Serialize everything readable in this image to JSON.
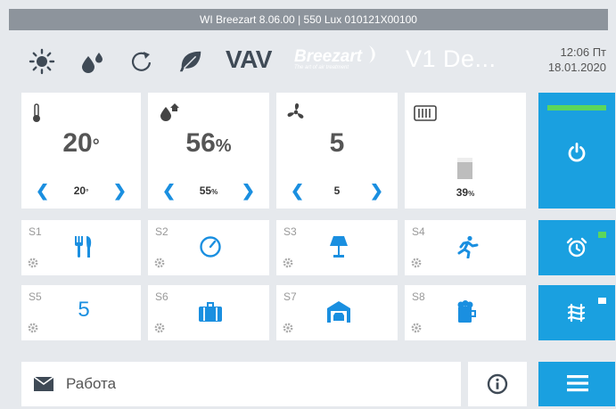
{
  "titlebar": {
    "text": "WI Breezart 8.06.00 | 550 Lux 010121X00100"
  },
  "topbar": {
    "icons": [
      "sun-icon",
      "humidity-drops-icon",
      "recirculation-icon",
      "leaf-icon"
    ],
    "vav_label": "VAV",
    "brand_name": "Breezart",
    "brand_tagline": "The art of air treatment",
    "device_name": "V1 De...",
    "time": "12:06 Пт",
    "date": "18.01.2020"
  },
  "tiles": {
    "temperature": {
      "icon": "thermometer-icon",
      "value": "20",
      "unit": "°",
      "setpoint": "20",
      "setpoint_unit": "°"
    },
    "humidity": {
      "icon": "home-humidity-icon",
      "value": "56",
      "unit": "%",
      "setpoint": "55",
      "setpoint_unit": "%"
    },
    "fan": {
      "icon": "fan-icon",
      "value": "5",
      "setpoint": "5"
    },
    "filter": {
      "icon": "filter-icon",
      "level_percent": 39,
      "label": "39",
      "unit": "%"
    }
  },
  "scenes": [
    {
      "label": "S1",
      "icon": "fork-knife-icon"
    },
    {
      "label": "S2",
      "icon": "gauge-icon"
    },
    {
      "label": "S3",
      "icon": "lamp-icon"
    },
    {
      "label": "S4",
      "icon": "running-person-icon"
    },
    {
      "label": "S5",
      "value": "5"
    },
    {
      "label": "S6",
      "icon": "suitcase-icon"
    },
    {
      "label": "S7",
      "icon": "garage-icon"
    },
    {
      "label": "S8",
      "icon": "beer-mug-icon"
    }
  ],
  "message": {
    "icon": "envelope-icon",
    "text": "Работа"
  },
  "colors": {
    "accent": "#1aa0e0",
    "power_indicator": "#5cd65c",
    "alarm_indicator": "#5cd65c",
    "background": "#e6e9ed"
  }
}
